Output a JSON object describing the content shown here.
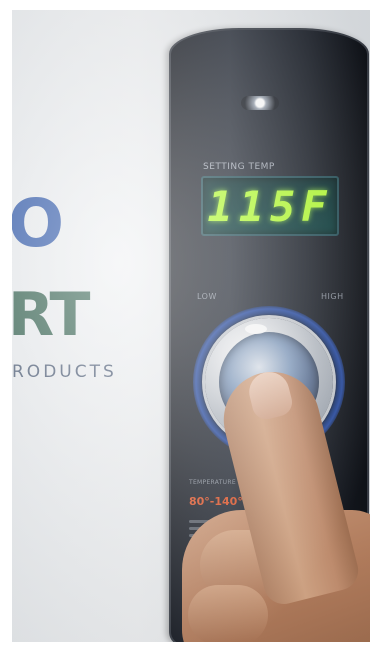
{
  "brand": {
    "fragment_1": "O",
    "fragment_2": "RT",
    "fragment_3": "RODUCTS"
  },
  "panel": {
    "display_caption": "SETTING TEMP",
    "display_value": "115F",
    "scale_low": "LOW",
    "scale_high": "HIGH",
    "range_caption": "TEMPERATURE",
    "range_text": "80°-140°F"
  },
  "colors": {
    "display_digits": "#b6ff38",
    "panel_body": "#1d222b",
    "knob_ring": "#2a4ea6",
    "range_text": "#e35a2f"
  }
}
